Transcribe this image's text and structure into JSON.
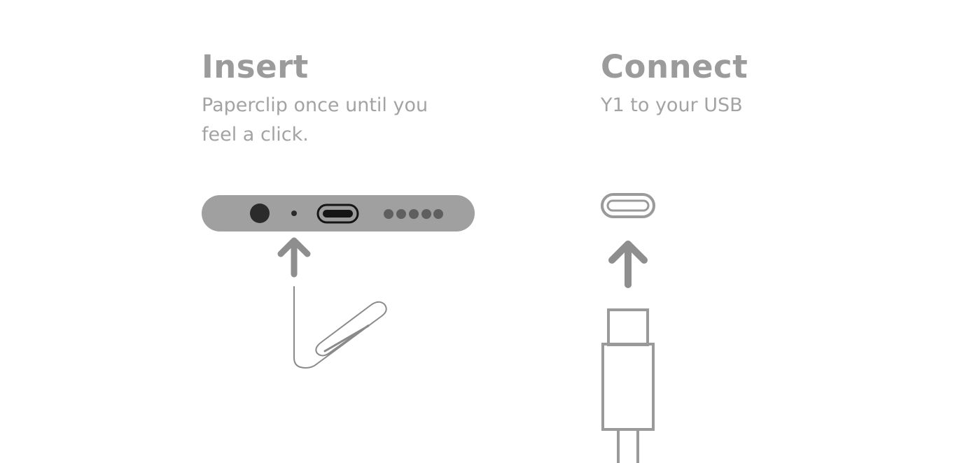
{
  "steps": [
    {
      "title": "Insert",
      "description": "Paperclip once until you feel a click."
    },
    {
      "title": "Connect",
      "description": "Y1 to your USB"
    }
  ],
  "colors": {
    "device": "#a0a0a0",
    "port_dark": "#2b2b2b",
    "dots": "#5f5f5f",
    "arrow": "#8e8e8e",
    "outline": "#9a9a9a",
    "text": "#9b9b9b"
  },
  "icons": [
    "device-bottom-edge",
    "reset-pinhole",
    "usb-c-port",
    "speaker-grille",
    "up-arrow-icon",
    "paperclip-icon",
    "usb-c-port-icon",
    "usb-c-plug-icon"
  ]
}
